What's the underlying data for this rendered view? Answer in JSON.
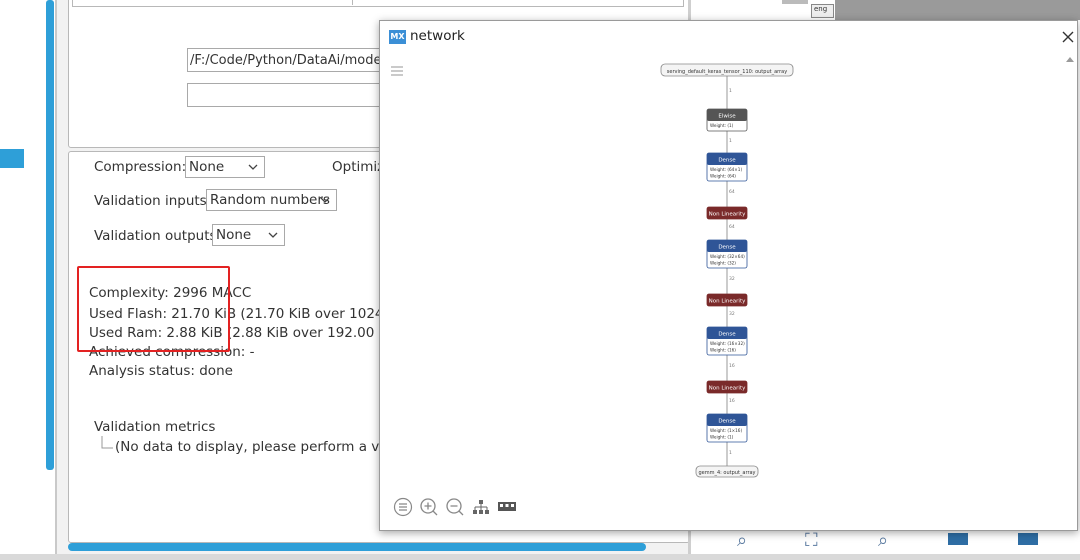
{
  "main": {
    "path_value": "/F:/Code/Python/DataAi/model.t",
    "compression": {
      "label": "Compression:",
      "value": "None"
    },
    "optimization_label": "Optimiz",
    "validation_inputs": {
      "label": "Validation inputs:",
      "value": "Random numbers"
    },
    "validation_outputs": {
      "label": "Validation outputs:",
      "value": "None"
    },
    "stats": {
      "complexity": "Complexity:  2996 MACC",
      "used_flash": "Used Flash: 21.70 KiB (21.70 KiB over 1024.00 K",
      "used_ram": "Used Ram: 2.88 KiB (2.88 KiB over 192.00 KiB In",
      "achieved_compression": "Achieved compression: -",
      "analysis_status": "Analysis status: done"
    },
    "validation_metrics": {
      "title": "Validation metrics",
      "empty_message": "(No data to display, please perform a validati"
    }
  },
  "right_panel": {
    "top_item": "eng"
  },
  "network_window": {
    "logo": "MX",
    "title": "network",
    "close_icon": "close-icon",
    "graph": {
      "input_node": "serving_default_keras_tensor_110: output_array",
      "output_node": "gemm_4: output_array",
      "nodes": [
        {
          "name": "Elwise",
          "color": "#555555",
          "lines": [
            "Weight: (1)"
          ]
        },
        {
          "name": "Dense",
          "color": "#2f5597",
          "lines": [
            "Weight: (64×1)",
            "Weight: (64)"
          ]
        },
        {
          "name": "Non Linearity",
          "color": "#7a2a2a",
          "lines": []
        },
        {
          "name": "Dense",
          "color": "#2f5597",
          "lines": [
            "Weight: (32×64)",
            "Weight: (32)"
          ]
        },
        {
          "name": "Non Linearity",
          "color": "#7a2a2a",
          "lines": []
        },
        {
          "name": "Dense",
          "color": "#2f5597",
          "lines": [
            "Weight: (16×32)",
            "Weight: (16)"
          ]
        },
        {
          "name": "Non Linearity",
          "color": "#7a2a2a",
          "lines": []
        },
        {
          "name": "Dense",
          "color": "#2f5597",
          "lines": [
            "Weight: (1×16)",
            "Weight: (1)"
          ]
        }
      ],
      "edge_labels": [
        "1",
        "1",
        "64",
        "64",
        "32",
        "32",
        "16",
        "16",
        "1"
      ]
    },
    "toolbar": [
      "list-icon",
      "zoom-in-icon",
      "zoom-out-icon",
      "hierarchy-icon",
      "grid-icon"
    ]
  },
  "colors": {
    "accent": "#2e9fd8",
    "highlight": "#e32222",
    "dense": "#2f5597",
    "nonlinear": "#7a2a2a",
    "elwise": "#555555"
  }
}
